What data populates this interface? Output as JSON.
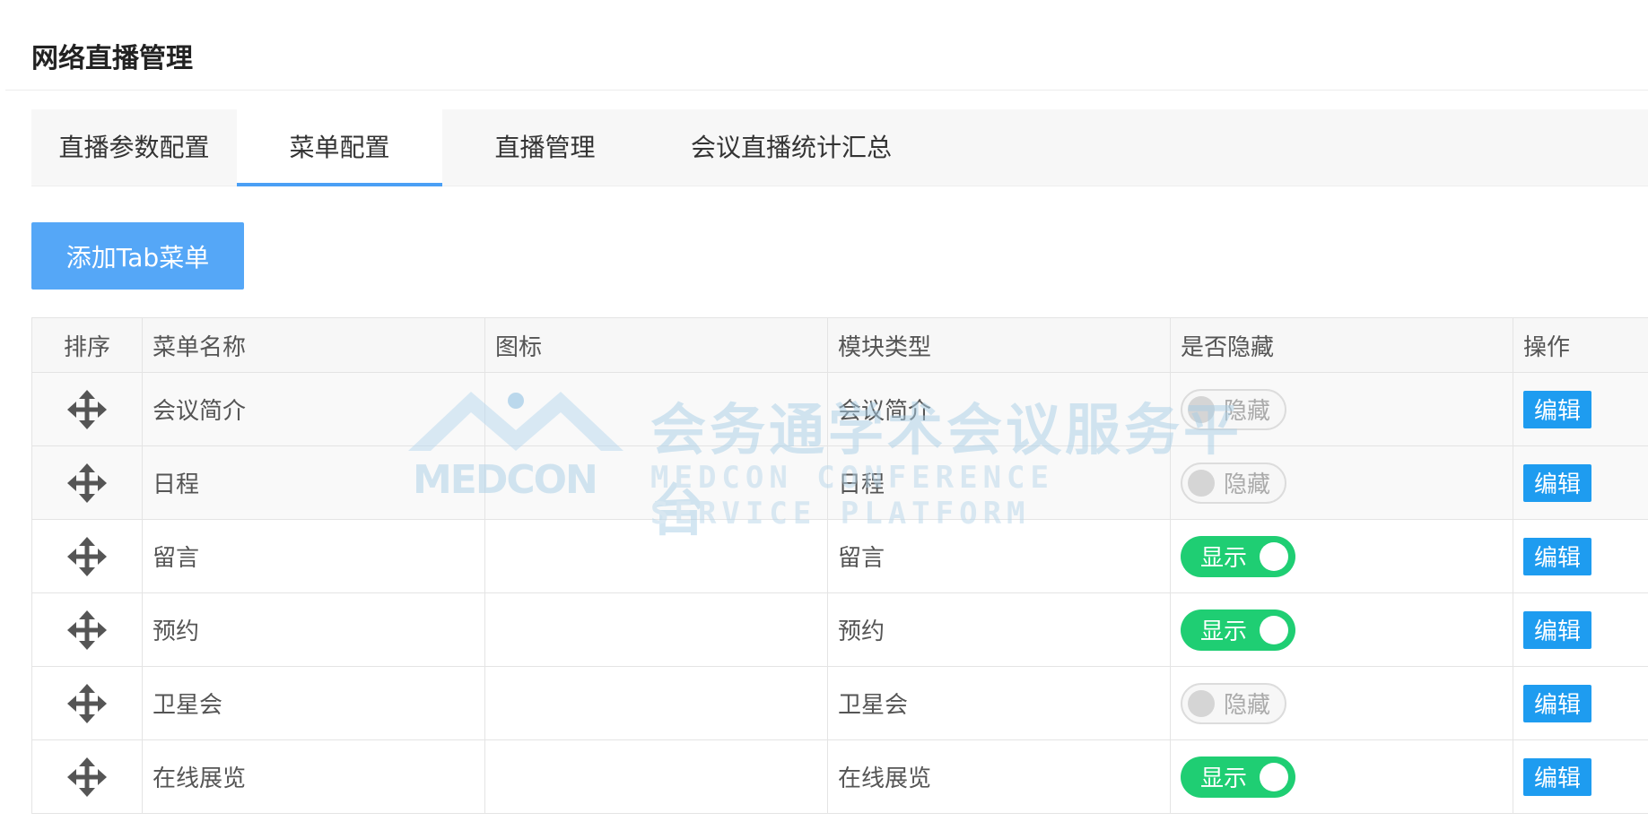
{
  "page": {
    "title": "网络直播管理"
  },
  "tabs": [
    {
      "label": "直播参数配置",
      "active": false
    },
    {
      "label": "菜单配置",
      "active": true
    },
    {
      "label": "直播管理",
      "active": false
    },
    {
      "label": "会议直播统计汇总",
      "active": false
    }
  ],
  "toolbar": {
    "add_label": "添加Tab菜单"
  },
  "table": {
    "columns": [
      "排序",
      "菜单名称",
      "图标",
      "模块类型",
      "是否隐藏",
      "操作"
    ],
    "rows": [
      {
        "name": "会议简介",
        "icon": "",
        "module": "会议简介",
        "visibility": "隐藏",
        "visible": false,
        "action": "编辑"
      },
      {
        "name": "日程",
        "icon": "",
        "module": "日程",
        "visibility": "隐藏",
        "visible": false,
        "action": "编辑"
      },
      {
        "name": "留言",
        "icon": "",
        "module": "留言",
        "visibility": "显示",
        "visible": true,
        "action": "编辑"
      },
      {
        "name": "预约",
        "icon": "",
        "module": "预约",
        "visibility": "显示",
        "visible": true,
        "action": "编辑"
      },
      {
        "name": "卫星会",
        "icon": "",
        "module": "卫星会",
        "visibility": "隐藏",
        "visible": false,
        "action": "编辑"
      },
      {
        "name": "在线展览",
        "icon": "",
        "module": "在线展览",
        "visibility": "显示",
        "visible": true,
        "action": "编辑"
      }
    ]
  },
  "watermark": {
    "brand": "MEDCON",
    "cn": "会务通学术会议服务平台",
    "en": "MEDCON CONFERENCE SERVICE PLATFORM"
  },
  "colors": {
    "accent": "#4a9ff5",
    "add_button": "#55a7f7",
    "edit_button": "#1e9cf0",
    "toggle_on": "#1fce73",
    "toggle_off": "#d5d5d5"
  },
  "icons": {
    "sort_handle": "move-arrows-icon"
  }
}
